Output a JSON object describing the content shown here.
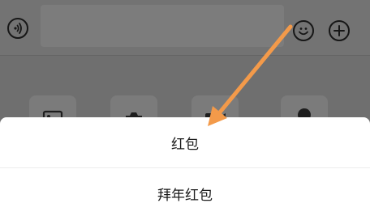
{
  "chat_input_bar": {
    "left_icon": "voice-icon",
    "right_icons": [
      "emoji-icon",
      "plus-icon"
    ]
  },
  "tool_panel": {
    "tiles": [
      "image-icon",
      "camera-icon",
      "video-icon",
      "location-icon"
    ]
  },
  "action_sheet": {
    "options": [
      {
        "label": "红包"
      },
      {
        "label": "拜年红包"
      }
    ]
  },
  "annotation": {
    "arrow_color": "#F39A4A",
    "target": "红包"
  },
  "colors": {
    "dim": "#6f6f6f",
    "sheet_bg": "#ffffff",
    "text": "#1a1a1a",
    "separator": "#ececec"
  }
}
